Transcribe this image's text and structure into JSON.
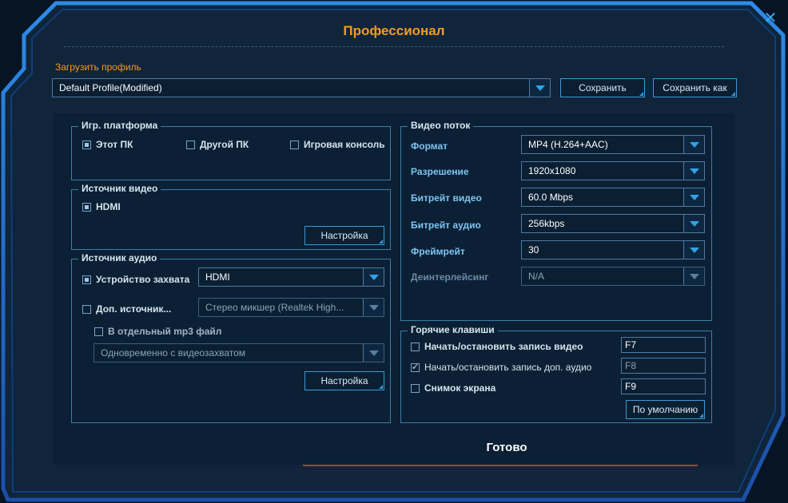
{
  "window": {
    "title": "Профессионал",
    "close_glyph": "✕"
  },
  "profile": {
    "label": "Загрузить профиль",
    "selected": "Default Profile(Modified)",
    "save_label": "Сохранить",
    "save_as_label": "Сохранить как"
  },
  "platform": {
    "title": "Игр. платформа",
    "options": [
      {
        "label": "Этот ПК",
        "checked": true
      },
      {
        "label": "Другой ПК",
        "checked": false
      },
      {
        "label": "Игровая консоль",
        "checked": false
      }
    ]
  },
  "video_source": {
    "title": "Источник видео",
    "option": {
      "label": "HDMI",
      "checked": true
    },
    "settings_label": "Настройка"
  },
  "audio_source": {
    "title": "Источник аудио",
    "capture_device": {
      "label": "Устройство захвата",
      "checked": true,
      "value": "HDMI"
    },
    "extra_source": {
      "label": "Доп. источник...",
      "checked": false,
      "value": "Стерео микшер (Realtek High..."
    },
    "mp3_file": {
      "label": "В отдельный mp3 файл",
      "checked": false
    },
    "mp3_mode": "Одновременно с видеозахватом",
    "settings_label": "Настройка"
  },
  "video_stream": {
    "title": "Видео поток",
    "fields": [
      {
        "label": "Формат",
        "value": "MP4 (H.264+AAC)"
      },
      {
        "label": "Разрешение",
        "value": "1920x1080"
      },
      {
        "label": "Битрейт видео",
        "value": "60.0 Mbps"
      },
      {
        "label": "Битрейт аудио",
        "value": "256kbps"
      },
      {
        "label": "Фреймрейт",
        "value": "30"
      },
      {
        "label": "Деинтерлейсинг",
        "value": "N/A"
      }
    ]
  },
  "hotkeys": {
    "title": "Горячие клавиши",
    "items": [
      {
        "label": "Начать/остановить запись видео",
        "checked": false,
        "key": "F7"
      },
      {
        "label": "Начать/остановить запись доп. аудио",
        "checked": true,
        "key": "F8"
      },
      {
        "label": "Снимок экрана",
        "checked": false,
        "key": "F9"
      }
    ],
    "defaults_label": "По умолчанию"
  },
  "done_label": "Готово",
  "colors": {
    "accent_orange": "#f39a22",
    "frame_blue": "#1e6fd0",
    "done_red": "#d41616"
  }
}
